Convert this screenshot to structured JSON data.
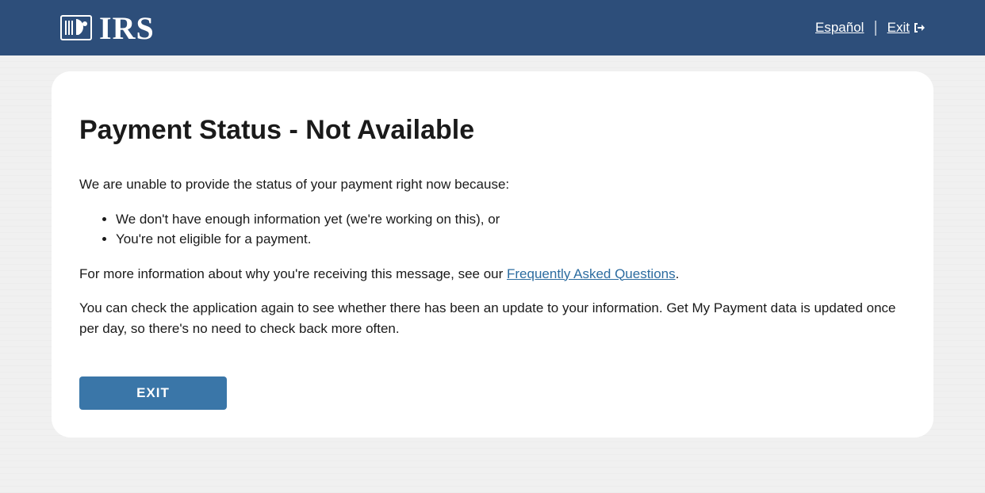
{
  "header": {
    "brand": "IRS",
    "language_link": "Español",
    "exit_link": "Exit "
  },
  "main": {
    "title": "Payment Status - Not Available",
    "intro": "We are unable to provide the status of your payment right now because:",
    "reasons": [
      "We don't have enough information yet (we're working on this), or",
      "You're not eligible for a payment."
    ],
    "faq_prefix": "For more information about why you're receiving this message, see our ",
    "faq_link_text": "Frequently Asked Questions",
    "faq_suffix": ".",
    "update_note": "You can check the application again to see whether there has been an update to your information. Get My Payment data is updated once per day, so there's no need to check back more often.",
    "exit_button": "EXIT"
  }
}
